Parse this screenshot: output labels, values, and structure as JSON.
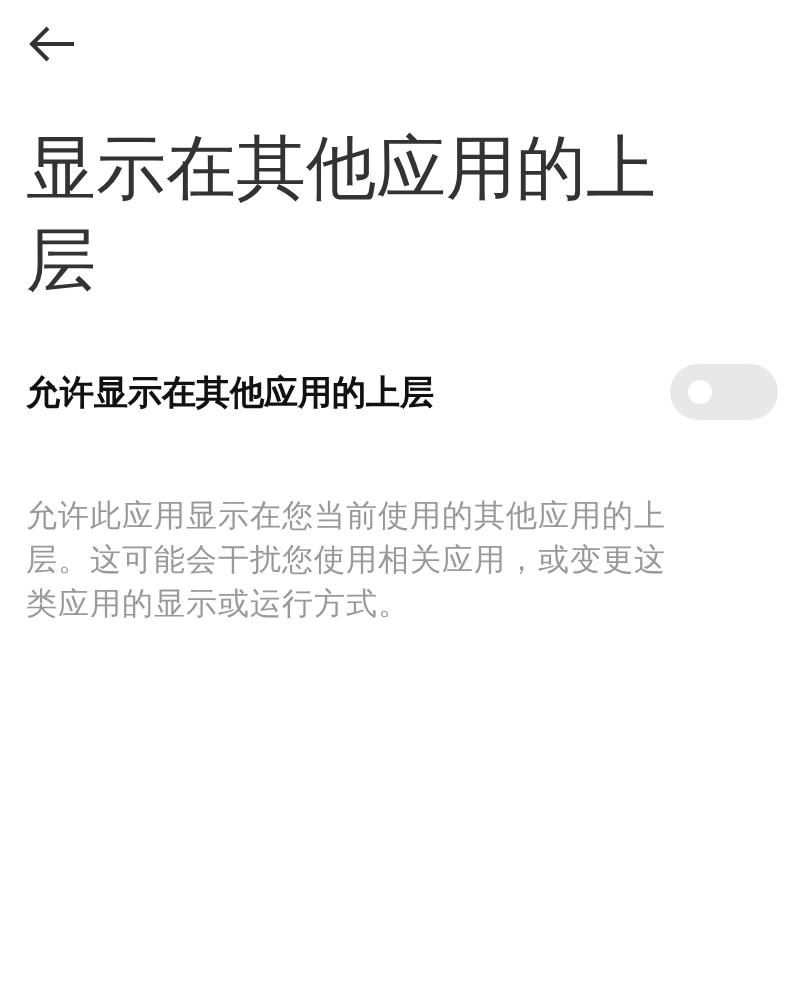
{
  "title": "显示在其他应用的上层",
  "setting": {
    "label": "允许显示在其他应用的上层",
    "on": false
  },
  "description": "允许此应用显示在您当前使用的其他应用的上层。这可能会干扰您使用相关应用，或变更这类应用的显示或运行方式。"
}
